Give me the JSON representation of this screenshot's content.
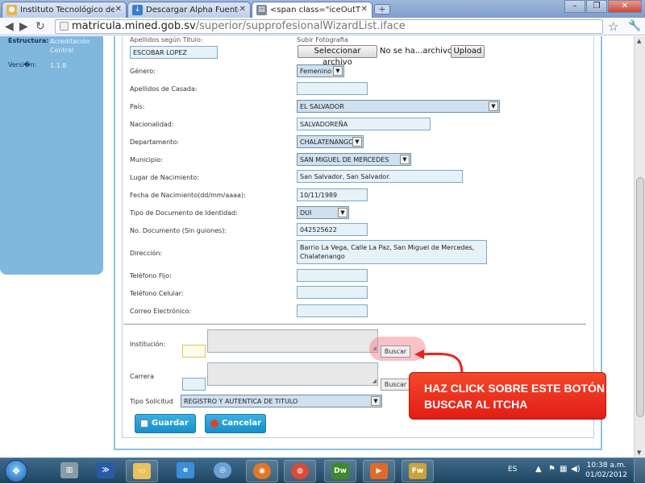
{
  "browser": {
    "tabs": [
      {
        "title": "Instituto Tecnológico de Ch",
        "favicon": "lightbulb-icon",
        "color": "#e9b44c"
      },
      {
        "title": "Descargar Alpha Fuente Vu",
        "favicon": "download-icon",
        "color": "#3c7dcc"
      },
      {
        "title": "<span class=\"iceOutTxt\" id",
        "favicon": "page-icon",
        "color": "#7a8a99"
      }
    ],
    "url": "matricula.mined.gob.sv/superior/supprofesionalWizardList.iface",
    "url_host": "matricula.mined.gob.sv",
    "url_path": "/superior/supprofesionalWizardList.iface"
  },
  "sidebar": {
    "estructura_label": "Estructura:",
    "estructura_value": "Acreditación Central",
    "version_label": "Versi�n:",
    "version_value": "1.1.8"
  },
  "form": {
    "apellidos_titulo_label": "Apellidos según Titulo:",
    "apellidos_titulo_value": "ESCOBAR LOPEZ",
    "subir_fotografia_label": "Subir Fotografia",
    "seleccionar_archivo": "Seleccionar archivo",
    "no_file_text": "No se ha...archivo",
    "upload_label": "Upload",
    "genero_label": "Género:",
    "genero_value": "Femenino",
    "apellidos_casada_label": "Apellidos de Casada:",
    "apellidos_casada_value": "",
    "pais_label": "País:",
    "pais_value": "EL SALVADOR",
    "nacionalidad_label": "Nacionalidad:",
    "nacionalidad_value": "SALVADOREÑA",
    "departamento_label": "Departamento:",
    "departamento_value": "CHALATENANGO",
    "municipio_label": "Municipio:",
    "municipio_value": "SAN MIGUEL DE MERCEDES",
    "lugar_nacimiento_label": "Lugar de Nacimiento:",
    "lugar_nacimiento_value": "San Salvador, San Salvador.",
    "fecha_nacimiento_label": "Fecha de Nacimiento(dd/mm/aaaa):",
    "fecha_nacimiento_value": "10/11/1989",
    "tipo_documento_label": "Tipo de Documento de Identidad:",
    "tipo_documento_value": "DUI",
    "no_documento_label": "No. Documento (Sin guiones):",
    "no_documento_value": "042525622",
    "direccion_label": "Dirección:",
    "direccion_line1": "Barrio La Vega, Calle La Paz, San Miguel de Mercedes,",
    "direccion_line2": "Chalatenango",
    "telefono_fijo_label": "Teléfono Fijo:",
    "telefono_celular_label": "Teléfono Celular:",
    "correo_label": "Correo Electrónico:",
    "institucion_label": "Institución:",
    "carrera_label": "Carrera",
    "buscar_label": "Buscar",
    "tipo_solicitud_label": "Tipo Solicitud",
    "tipo_solicitud_value": "REGISTRO Y AUTENTICA DE TITULO",
    "guardar_label": "Guardar",
    "cancelar_label": "Cancelar"
  },
  "annotation": {
    "line1": "HAZ CLICK SOBRE ESTE BOTÓN",
    "line2": "BUSCAR AL ITCHA",
    "color": "#e8231a"
  },
  "taskbar": {
    "items": [
      {
        "name": "start-orb",
        "glyph": "❖"
      },
      {
        "name": "network-monitor-icon",
        "glyph": "▥"
      },
      {
        "name": "powershell-icon",
        "glyph": "≫"
      },
      {
        "name": "explorer-folder-icon",
        "glyph": "▭"
      },
      {
        "name": "internet-explorer-icon",
        "glyph": "e"
      },
      {
        "name": "safari-icon",
        "glyph": "◎"
      },
      {
        "name": "firefox-icon",
        "glyph": "◉"
      },
      {
        "name": "chrome-icon",
        "glyph": "◍"
      },
      {
        "name": "dreamweaver-icon",
        "glyph": "Dw"
      },
      {
        "name": "media-player-icon",
        "glyph": "▶"
      },
      {
        "name": "fireworks-icon",
        "glyph": "Fw"
      }
    ],
    "language": "ES",
    "time": "10:38 a.m.",
    "date": "01/02/2012"
  }
}
